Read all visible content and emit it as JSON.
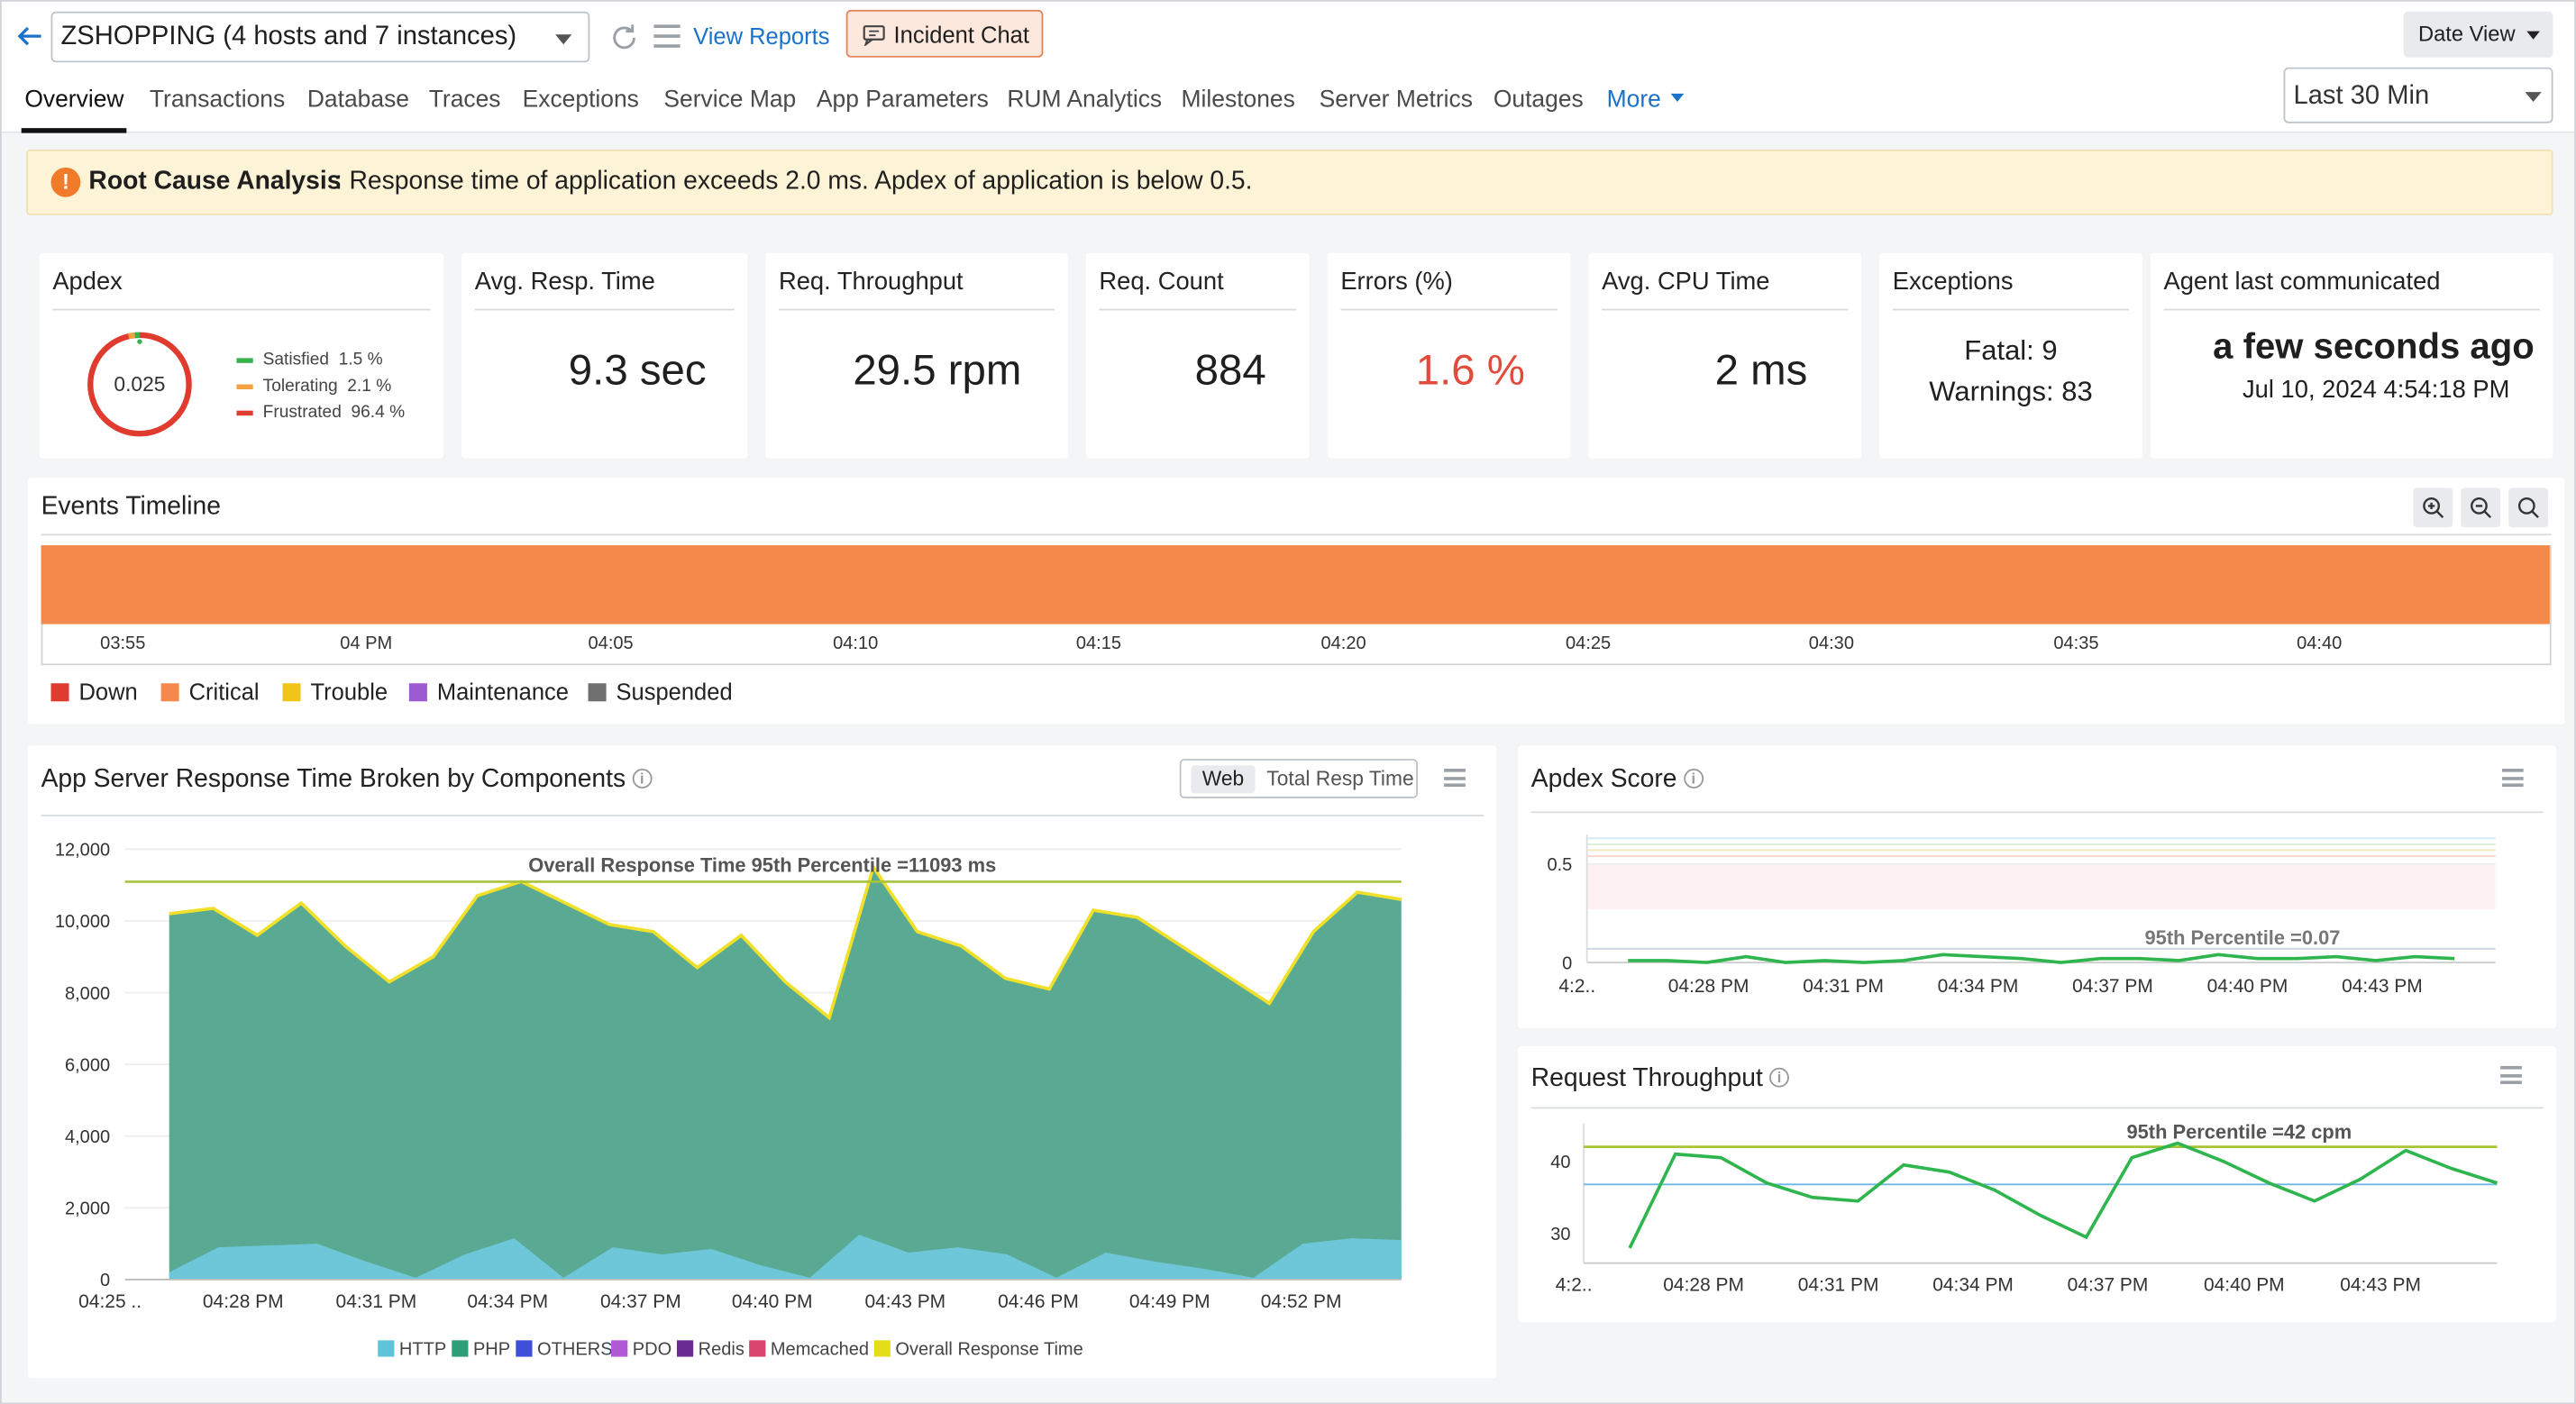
{
  "header": {
    "app_selector": "ZSHOPPING (4 hosts and 7 instances)",
    "view_reports": "View Reports",
    "incident_chat": "Incident Chat",
    "date_view": "Date View",
    "time_range": "Last 30 Min",
    "tabs": [
      "Overview",
      "Transactions",
      "Database",
      "Traces",
      "Exceptions",
      "Service Map",
      "App Parameters",
      "RUM Analytics",
      "Milestones",
      "Server Metrics",
      "Outages"
    ],
    "more": "More"
  },
  "rca": {
    "title": "Root Cause Analysis",
    "message": ": Response time of application exceeds 2.0 ms. Apdex of application is below 0.5."
  },
  "cards": {
    "apdex": {
      "label": "Apdex",
      "score": "0.025",
      "score_value": 0.025,
      "legend": [
        {
          "name": "Satisfied",
          "value": "1.5 %",
          "fraction": 0.015,
          "color": "#37b24d"
        },
        {
          "name": "Tolerating",
          "value": "2.1 %",
          "fraction": 0.021,
          "color": "#f5a142"
        },
        {
          "name": "Frustrated",
          "value": "96.4 %",
          "fraction": 0.964,
          "color": "#e03b2f"
        }
      ]
    },
    "avg_resp": {
      "label": "Avg. Resp. Time",
      "value": "9.3 sec"
    },
    "throughput": {
      "label": "Req. Throughput",
      "value": "29.5 rpm"
    },
    "count": {
      "label": "Req. Count",
      "value": "884"
    },
    "errors": {
      "label": "Errors (%)",
      "value": "1.6 %"
    },
    "cpu": {
      "label": "Avg. CPU Time",
      "value": "2 ms"
    },
    "exceptions": {
      "label": "Exceptions",
      "fatal": "Fatal: 9",
      "warnings": "Warnings: 83"
    },
    "agent": {
      "label": "Agent last communicated",
      "value": "a few seconds ago",
      "timestamp": "Jul 10, 2024 4:54:18 PM"
    }
  },
  "timeline": {
    "title": "Events Timeline",
    "status": "Critical",
    "ticks": [
      "03:55",
      "04 PM",
      "04:05",
      "04:10",
      "04:15",
      "04:20",
      "04:25",
      "04:30",
      "04:35",
      "04:40"
    ],
    "legend": [
      {
        "name": "Down",
        "color": "#e03b2f"
      },
      {
        "name": "Critical",
        "color": "#f5894b"
      },
      {
        "name": "Trouble",
        "color": "#f0c419"
      },
      {
        "name": "Maintenance",
        "color": "#9c5bd1"
      },
      {
        "name": "Suspended",
        "color": "#707070"
      }
    ]
  },
  "charts": {
    "response": {
      "title": "App Server Response Time Broken by Components",
      "seg_on": "Web",
      "seg_off": "Total Resp Time",
      "annotation": "Overall Response Time 95th Percentile =11093 ms",
      "legend": [
        {
          "name": "HTTP",
          "color": "#5ec5d9"
        },
        {
          "name": "PHP",
          "color": "#2e9e78"
        },
        {
          "name": "OTHERS",
          "color": "#3d4fd8"
        },
        {
          "name": "PDO",
          "color": "#b259d6"
        },
        {
          "name": "Redis",
          "color": "#6a2c91"
        },
        {
          "name": "Memcached",
          "color": "#d9456c"
        },
        {
          "name": "Overall Response Time",
          "color": "#e6dd1a"
        }
      ]
    },
    "apdex": {
      "title": "Apdex Score",
      "annotation": "95th Percentile =0.07"
    },
    "throughput": {
      "title": "Request Throughput",
      "annotation": "95th Percentile =42 cpm"
    }
  },
  "chart_data": [
    {
      "type": "area",
      "title": "App Server Response Time Broken by Components",
      "xlabel": "",
      "ylabel": "",
      "x_ticks": [
        "04:25 ..",
        "04:28 PM",
        "04:31 PM",
        "04:34 PM",
        "04:37 PM",
        "04:40 PM",
        "04:43 PM",
        "04:46 PM",
        "04:49 PM",
        "04:52 PM"
      ],
      "y_ticks": [
        "0",
        "2,000",
        "4,000",
        "6,000",
        "8,000",
        "10,000",
        "12,000"
      ],
      "ylim": [
        0,
        12000
      ],
      "series": [
        {
          "name": "HTTP",
          "values": [
            200,
            900,
            950,
            1000,
            500,
            50,
            700,
            1150,
            50,
            900,
            700,
            850,
            400,
            50,
            1250,
            750,
            900,
            700,
            50,
            750,
            500,
            300,
            50,
            1000,
            1150,
            1100
          ]
        },
        {
          "name": "Overall Response Time",
          "values": [
            10200,
            10350,
            9600,
            10500,
            9300,
            8300,
            9000,
            10700,
            11100,
            10500,
            9900,
            9700,
            8700,
            9600,
            8300,
            7300,
            11500,
            9700,
            9300,
            8400,
            8100,
            10300,
            10100,
            9300,
            8500,
            7700,
            9700,
            10800,
            10600
          ]
        }
      ],
      "percentile_95": 11093
    },
    {
      "type": "line",
      "title": "Apdex Score",
      "x_ticks": [
        "4:2..",
        "04:28 PM",
        "04:31 PM",
        "04:34 PM",
        "04:37 PM",
        "04:40 PM",
        "04:43 PM"
      ],
      "y_ticks": [
        "0",
        "0.5"
      ],
      "ylim": [
        0,
        1
      ],
      "series": [
        {
          "name": "",
          "values": [
            0.01,
            0.01,
            0.0,
            0.03,
            0.0,
            0.01,
            0.0,
            0.01,
            0.04,
            0.03,
            0.02,
            0.0,
            0.02,
            0.02,
            0.01,
            0.04,
            0.02,
            0.02,
            0.03,
            0.01,
            0.03,
            0.02
          ]
        }
      ],
      "percentile_95": 0.07
    },
    {
      "type": "line",
      "title": "Request Throughput",
      "x_ticks": [
        "4:2..",
        "04:28 PM",
        "04:31 PM",
        "04:34 PM",
        "04:37 PM",
        "04:40 PM",
        "04:43 PM"
      ],
      "y_ticks": [
        "30",
        "40"
      ],
      "ylim": [
        25,
        45
      ],
      "series": [
        {
          "name": "",
          "values": [
            28,
            41,
            40.5,
            37,
            35,
            34.5,
            39.5,
            38.5,
            36,
            32.5,
            29.5,
            40.5,
            42.5,
            40,
            37,
            34.5,
            37.5,
            41.5,
            39,
            37
          ]
        }
      ],
      "percentile_95": 42
    }
  ]
}
